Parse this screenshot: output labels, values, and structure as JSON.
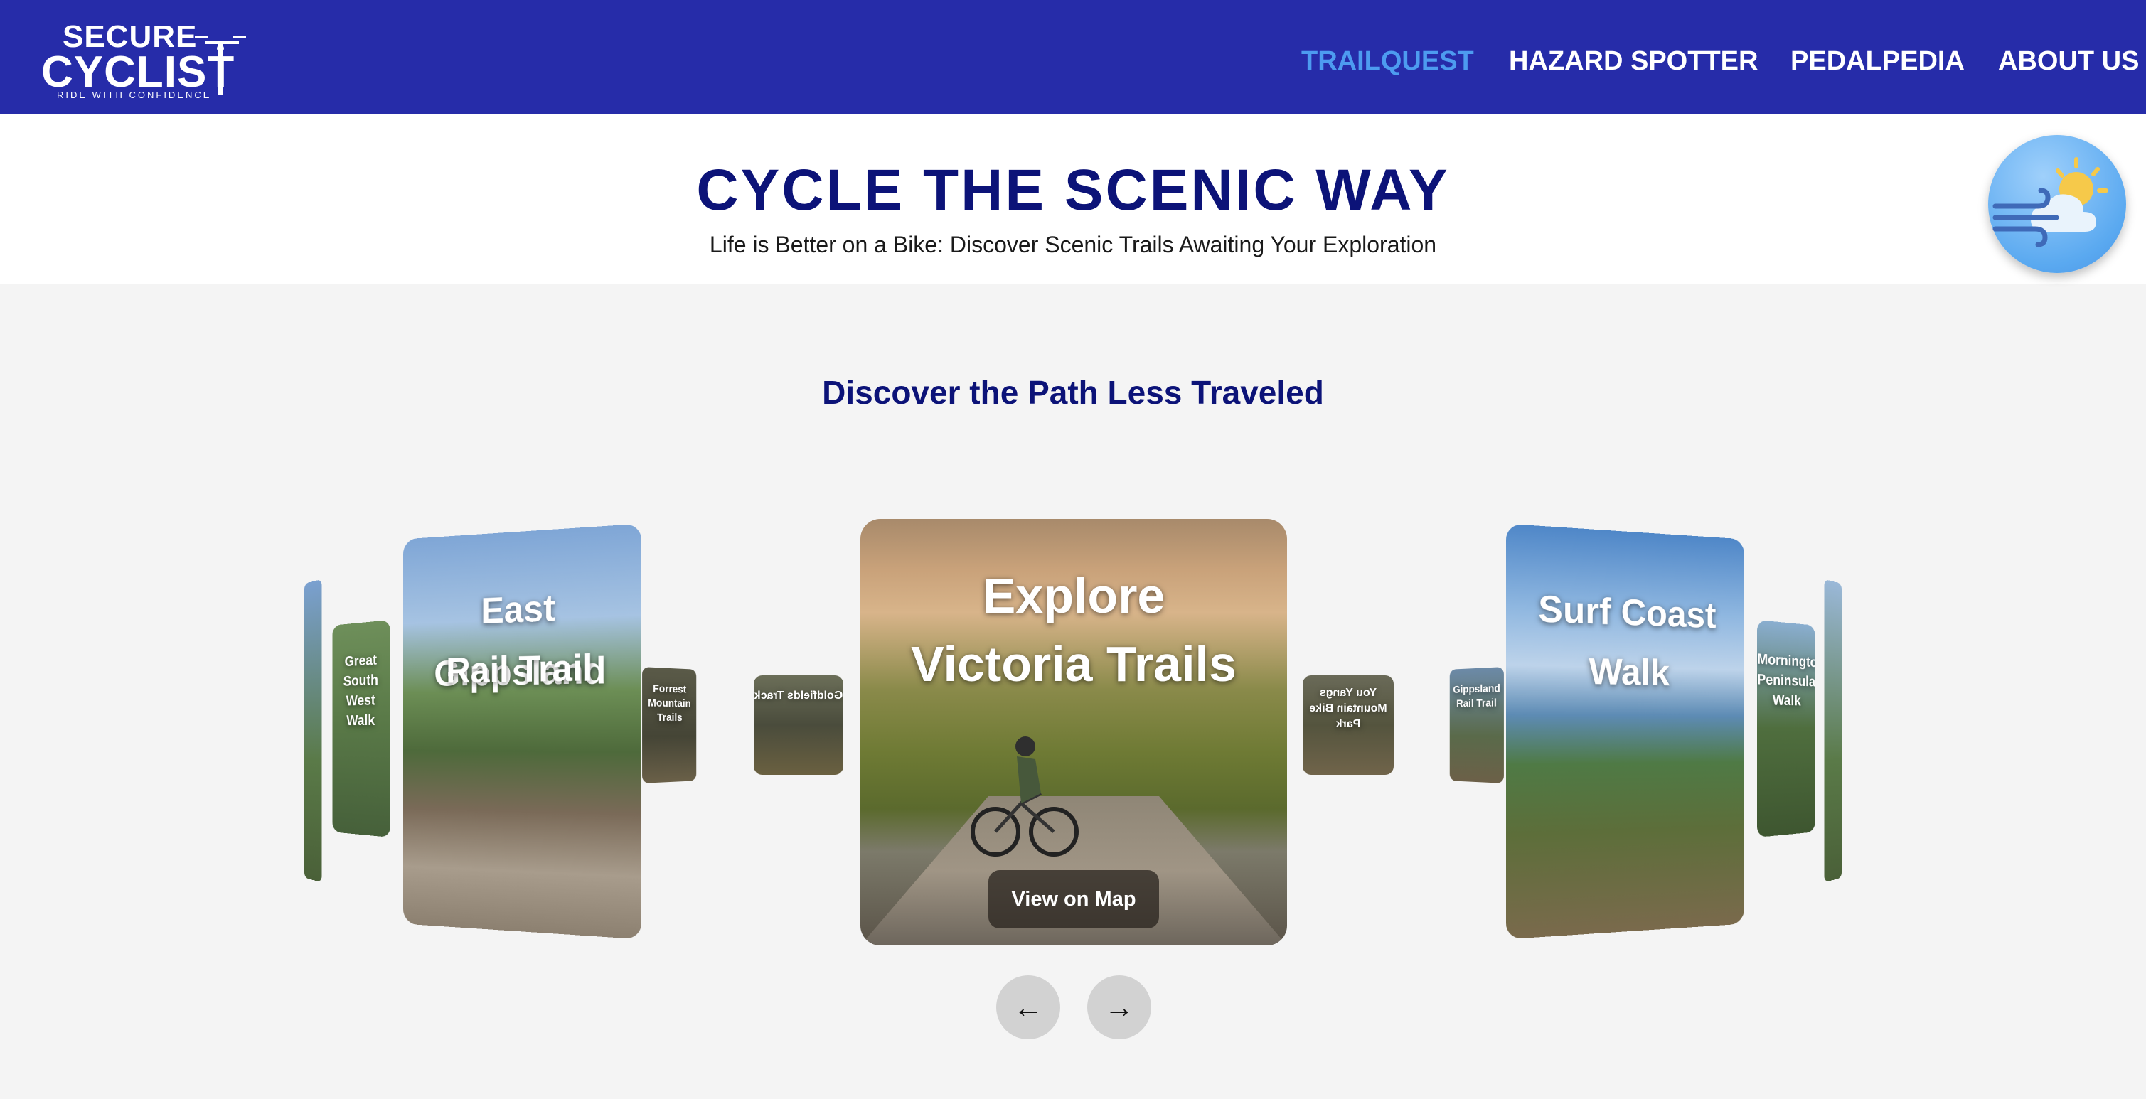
{
  "brand": {
    "name_line1": "SECURE",
    "name_line2": "CYCLIST",
    "tagline": "RIDE WITH CONFIDENCE"
  },
  "nav": {
    "items": [
      {
        "label": "TRAILQUEST",
        "active": true
      },
      {
        "label": "HAZARD SPOTTER",
        "active": false
      },
      {
        "label": "PEDALPEDIA",
        "active": false
      },
      {
        "label": "ABOUT US",
        "active": false
      }
    ]
  },
  "hero": {
    "title": "CYCLE THE SCENIC WAY",
    "subtitle": "Life is Better on a Bike: Discover Scenic Trails Awaiting Your Exploration"
  },
  "weather_widget": {
    "icon": "wind-cloud-sun-icon"
  },
  "section": {
    "title": "Discover the Path Less Traveled"
  },
  "carousel": {
    "main": {
      "title_line1": "Explore",
      "title_line2": "Victoria Trails",
      "button": "View on Map"
    },
    "left_big": {
      "line1": "East Gippsland",
      "line2": "Rail Trail"
    },
    "right_big": {
      "line1": "Surf Coast",
      "line2": "Walk"
    },
    "small_left_1": "Goldfields Track",
    "small_right_1": "You Yangs Mountain Bike Park",
    "small_left_2": "Forrest Mountain Trails",
    "small_right_2": "Gippsland Rail Trail",
    "small_left_3": "Great South West Walk",
    "small_right_3": "Mornington Peninsula Walk",
    "prev_icon": "←",
    "next_icon": "→"
  },
  "colors": {
    "navbar": "#262ca9",
    "active_nav": "#4d9bf0",
    "title": "#0c1378",
    "page_bg": "#f4f4f4"
  }
}
